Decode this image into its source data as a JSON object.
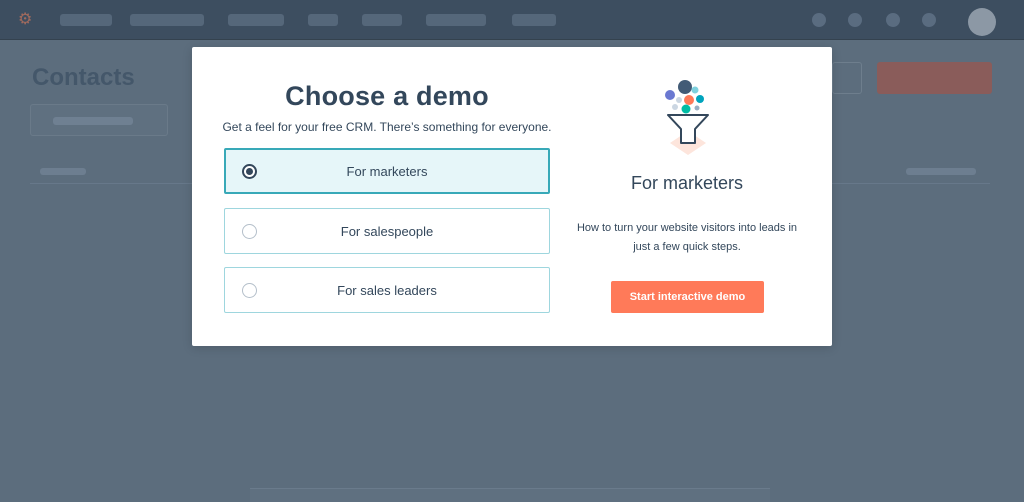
{
  "background": {
    "page_title": "Contacts"
  },
  "modal": {
    "title": "Choose a demo",
    "subtitle": "Get a feel for your free CRM. There’s something for everyone.",
    "options": [
      {
        "label": "For marketers",
        "selected": true
      },
      {
        "label": "For salespeople",
        "selected": false
      },
      {
        "label": "For sales leaders",
        "selected": false
      }
    ],
    "detail": {
      "icon": "funnel-illustration-icon",
      "title": "For marketers",
      "description": "How to turn your website visitors into leads in just a few quick steps.",
      "cta_label": "Start interactive demo"
    }
  },
  "colors": {
    "accent": "#ff7a59",
    "selected_border": "#38a9b8",
    "selected_bg": "#e6f6f9",
    "text": "#33475b",
    "overlay": "#5c6d7d"
  }
}
